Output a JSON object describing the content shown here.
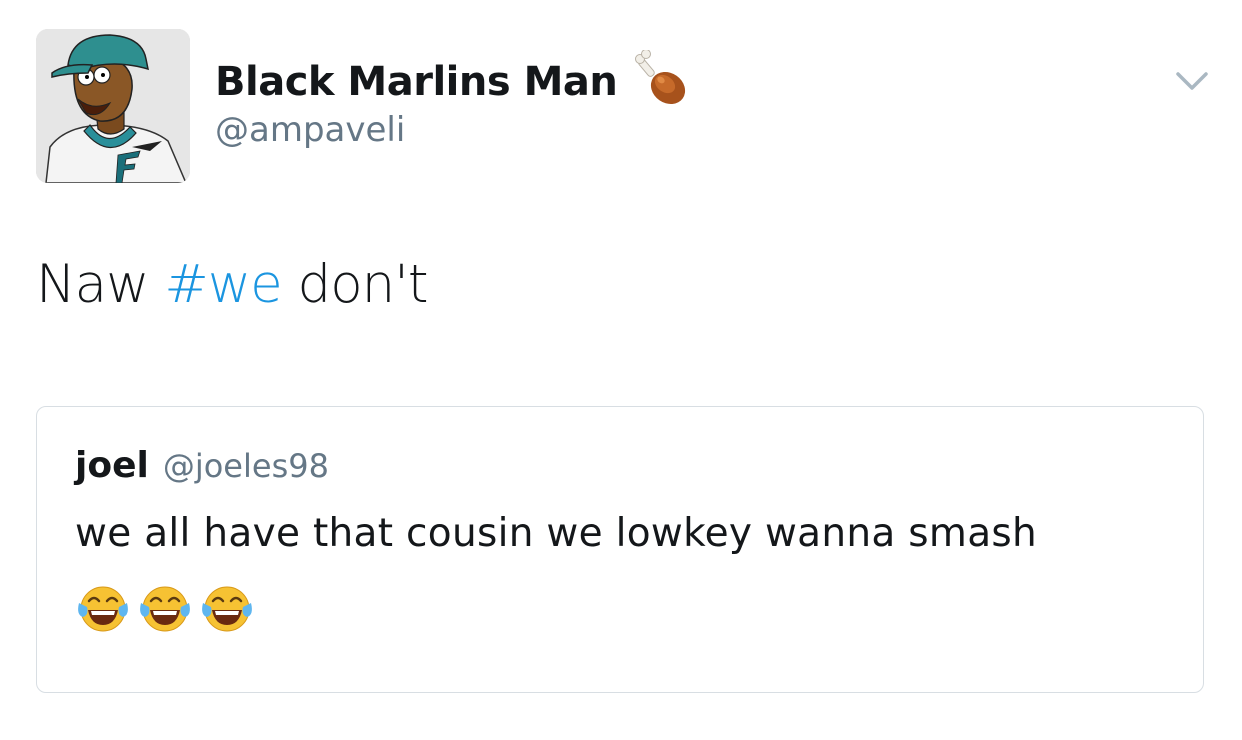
{
  "tweet": {
    "author": {
      "display_name": "Black Marlins Man",
      "name_emoji": "poultry-leg-emoji",
      "handle": "@ampaveli",
      "avatar": "cartoon-baseball-player-avatar"
    },
    "text_before": "Naw ",
    "hashtag": "#we",
    "text_after": " don't",
    "menu_icon": "chevron-down-icon",
    "colors": {
      "text": "#14171a",
      "secondary": "#657786",
      "link": "#1b95e0",
      "border": "#d8dee3"
    }
  },
  "quoted_tweet": {
    "author_name": "joel",
    "handle": "@joeles98",
    "text": "we all have that cousin we lowkey wanna smash",
    "emojis": [
      "face-with-tears-of-joy-emoji",
      "face-with-tears-of-joy-emoji",
      "face-with-tears-of-joy-emoji"
    ]
  }
}
